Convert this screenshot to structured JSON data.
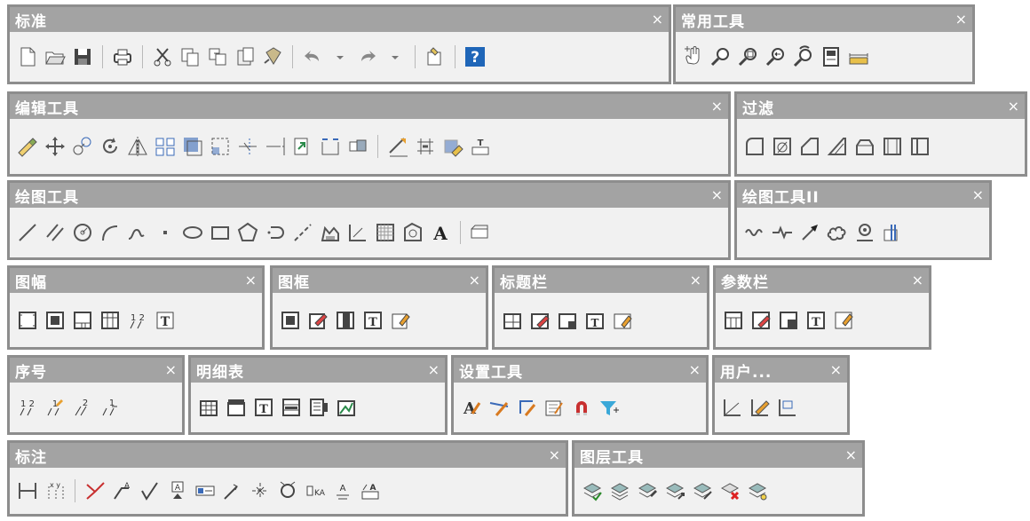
{
  "toolbars": {
    "standard": {
      "title": "标准",
      "close": "×"
    },
    "common": {
      "title": "常用工具",
      "close": "×"
    },
    "edit": {
      "title": "编辑工具",
      "close": "×"
    },
    "filter": {
      "title": "过滤",
      "close": "×"
    },
    "draw": {
      "title": "绘图工具",
      "close": "×"
    },
    "draw2": {
      "title": "绘图工具II",
      "close": "×"
    },
    "frame": {
      "title": "图幅",
      "close": "×"
    },
    "border": {
      "title": "图框",
      "close": "×"
    },
    "titlebar": {
      "title": "标题栏",
      "close": "×"
    },
    "params": {
      "title": "参数栏",
      "close": "×"
    },
    "serial": {
      "title": "序号",
      "close": "×"
    },
    "detail": {
      "title": "明细表",
      "close": "×"
    },
    "setup": {
      "title": "设置工具",
      "close": "×"
    },
    "user": {
      "title": "用户...",
      "close": "×"
    },
    "dim": {
      "title": "标注",
      "close": "×"
    },
    "layer": {
      "title": "图层工具",
      "close": "×"
    }
  },
  "icons": {
    "standard": [
      "new-document-icon",
      "open-folder-icon",
      "save-icon",
      "|",
      "print-icon",
      "|",
      "cut-icon",
      "copy-icon",
      "copy-paste-icon",
      "paste-icon",
      "match-properties-icon",
      "|",
      "undo-icon",
      "undo-dropdown-icon",
      "redo-icon",
      "redo-dropdown-icon",
      "|",
      "design-center-icon",
      "|",
      "help-icon"
    ],
    "common": [
      "pan-hand-icon",
      "zoom-realtime-icon",
      "zoom-window-icon",
      "zoom-previous-icon",
      "zoom-all-icon",
      "properties-icon",
      "measure-icon"
    ],
    "edit": [
      "erase-icon",
      "move-icon",
      "copy-object-icon",
      "rotate-icon",
      "mirror-icon",
      "array-icon",
      "offset-icon",
      "scale-icon",
      "trim-icon",
      "extend-icon",
      "stretch-icon",
      "break-icon",
      "explode-icon",
      "|",
      "lengthen-icon",
      "align-icon",
      "match-icon",
      "attribute-edit-icon"
    ],
    "filter": [
      "fillet-icon",
      "chamfer-icon",
      "chamfer-line-icon",
      "double-chamfer-icon",
      "round-top-icon",
      "internal-fillet-icon",
      "corner-icon"
    ],
    "draw": [
      "line-icon",
      "parallel-line-icon",
      "circle-icon",
      "arc-icon",
      "spline-icon",
      "point-icon",
      "ellipse-icon",
      "rectangle-icon",
      "polygon-icon",
      "slot-icon",
      "centerline-icon",
      "hatch-icon",
      "dimension-icon",
      "boundary-icon",
      "region-icon",
      "text-icon",
      "|",
      "block-icon"
    ],
    "draw2": [
      "wave-line-icon",
      "break-line-icon",
      "arrow-icon",
      "cloud-icon",
      "nut-icon",
      "component-icon"
    ],
    "frame": [
      "frame-size-icon",
      "frame-border-icon",
      "frame-titlebar-icon",
      "frame-table-icon",
      "frame-serial-icon",
      "frame-text-icon"
    ],
    "border": [
      "border-insert-icon",
      "border-edit-icon",
      "border-table-icon",
      "border-text-icon",
      "border-attr-icon"
    ],
    "titlebar": [
      "titlebar-insert-icon",
      "titlebar-edit-icon",
      "titlebar-fill-icon",
      "titlebar-text-icon",
      "titlebar-attr-icon"
    ],
    "params": [
      "params-insert-icon",
      "params-edit-icon",
      "params-fill-icon",
      "params-text-icon",
      "params-attr-icon"
    ],
    "serial": [
      "serial-insert-icon",
      "serial-edit-icon",
      "serial-delete-icon",
      "serial-renumber-icon"
    ],
    "detail": [
      "detail-table-icon",
      "detail-header-icon",
      "detail-text-icon",
      "detail-fill-icon",
      "detail-export-icon",
      "detail-import-icon"
    ],
    "setup": [
      "text-style-icon",
      "dim-style-icon",
      "leader-style-icon",
      "table-style-icon",
      "magnet-icon",
      "filter-select-icon"
    ],
    "user": [
      "user-angle-icon",
      "user-angle-edit-icon",
      "user-coord-icon"
    ],
    "dim": [
      "linear-dim-icon",
      "coord-dim-icon",
      "|",
      "leader-dim-icon",
      "weld-symbol-icon",
      "roughness-icon",
      "datum-icon",
      "tolerance-icon",
      "chamfer-dim-icon",
      "center-mark-icon",
      "hole-dim-icon",
      "label-dim-icon",
      "text-dim-icon",
      "revision-icon"
    ],
    "layer": [
      "layer-manager-icon",
      "layer-state-icon",
      "layer-make-icon",
      "layer-move-icon",
      "layer-match-icon",
      "layer-delete-icon",
      "layer-isolate-icon"
    ]
  },
  "colors": {
    "titlebar": "#a3a3a3",
    "panel": "#f1f1f1",
    "border": "#8d8d8d",
    "help": "#1f66b8"
  }
}
